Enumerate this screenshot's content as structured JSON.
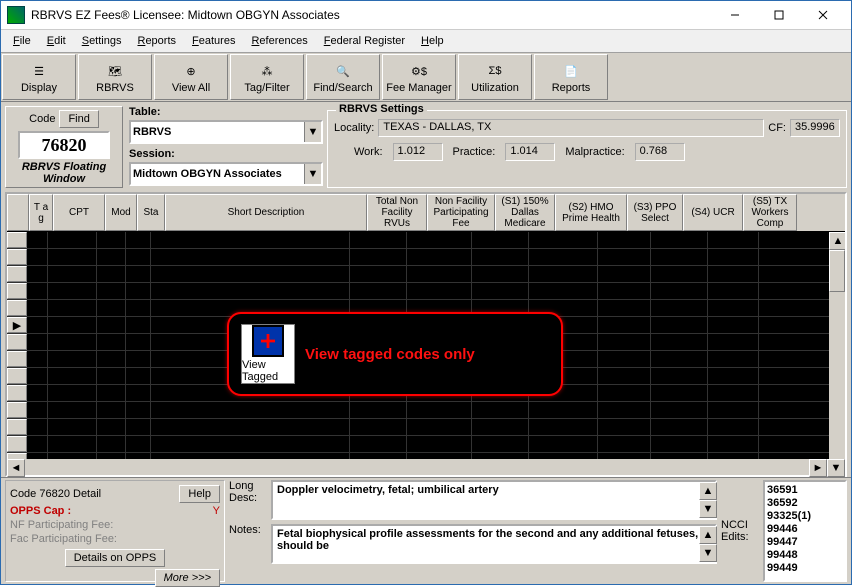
{
  "title": "RBRVS EZ Fees®  Licensee: Midtown OBGYN Associates",
  "menu": [
    "File",
    "Edit",
    "Settings",
    "Reports",
    "Features",
    "References",
    "Federal Register",
    "Help"
  ],
  "toolbar": [
    {
      "label": "Display",
      "name": "display-button"
    },
    {
      "label": "RBRVS",
      "name": "rbrvs-button"
    },
    {
      "label": "View All",
      "name": "view-all-button"
    },
    {
      "label": "Tag/Filter",
      "name": "tag-filter-button"
    },
    {
      "label": "Find/Search",
      "name": "find-search-button"
    },
    {
      "label": "Fee Manager",
      "name": "fee-manager-button"
    },
    {
      "label": "Utilization",
      "name": "utilization-button"
    },
    {
      "label": "Reports",
      "name": "reports-button"
    }
  ],
  "code": {
    "label": "Code",
    "find": "Find",
    "value": "76820",
    "caption": "RBRVS Floating Window"
  },
  "table": {
    "label": "Table:",
    "value": "RBRVS"
  },
  "session": {
    "label": "Session:",
    "value": "Midtown OBGYN Associates"
  },
  "settings": {
    "group": "RBRVS Settings",
    "locality_label": "Locality:",
    "locality": "TEXAS - DALLAS, TX",
    "cf_label": "CF:",
    "cf": "35.9996",
    "work_label": "Work:",
    "work": "1.012",
    "practice_label": "Practice:",
    "practice": "1.014",
    "malpractice_label": "Malpractice:",
    "malpractice": "0.768"
  },
  "columns": [
    "T a g",
    "CPT",
    "Mod",
    "Sta",
    "Short Description",
    "Total Non Facility RVUs",
    "Non Facility Participating Fee",
    "(S1) 150% Dallas Medicare",
    "(S2) HMO Prime Health",
    "(S3) PPO Select",
    "(S4) UCR",
    "(S5) TX Workers Comp"
  ],
  "tooltip": {
    "tile": "View Tagged",
    "msg": "View tagged codes only"
  },
  "detail": {
    "title": "Code 76820  Detail",
    "help": "Help",
    "opps_label": "OPPS Cap :",
    "opps_val": "Y",
    "nf_label": "NF Participating Fee:",
    "fac_label": "Fac Participating Fee:",
    "opps_btn": "Details on OPPS",
    "more": "More >>>",
    "long_label": "Long Desc:",
    "long": "Doppler velocimetry, fetal; umbilical artery",
    "notes_label": "Notes:",
    "notes": "Fetal biophysical profile assessments for the second and any additional fetuses, should be",
    "ncci_label": "NCCI Edits:",
    "ncci": [
      "36591",
      "36592",
      "93325(1)",
      "99446",
      "99447",
      "99448",
      "99449"
    ]
  }
}
